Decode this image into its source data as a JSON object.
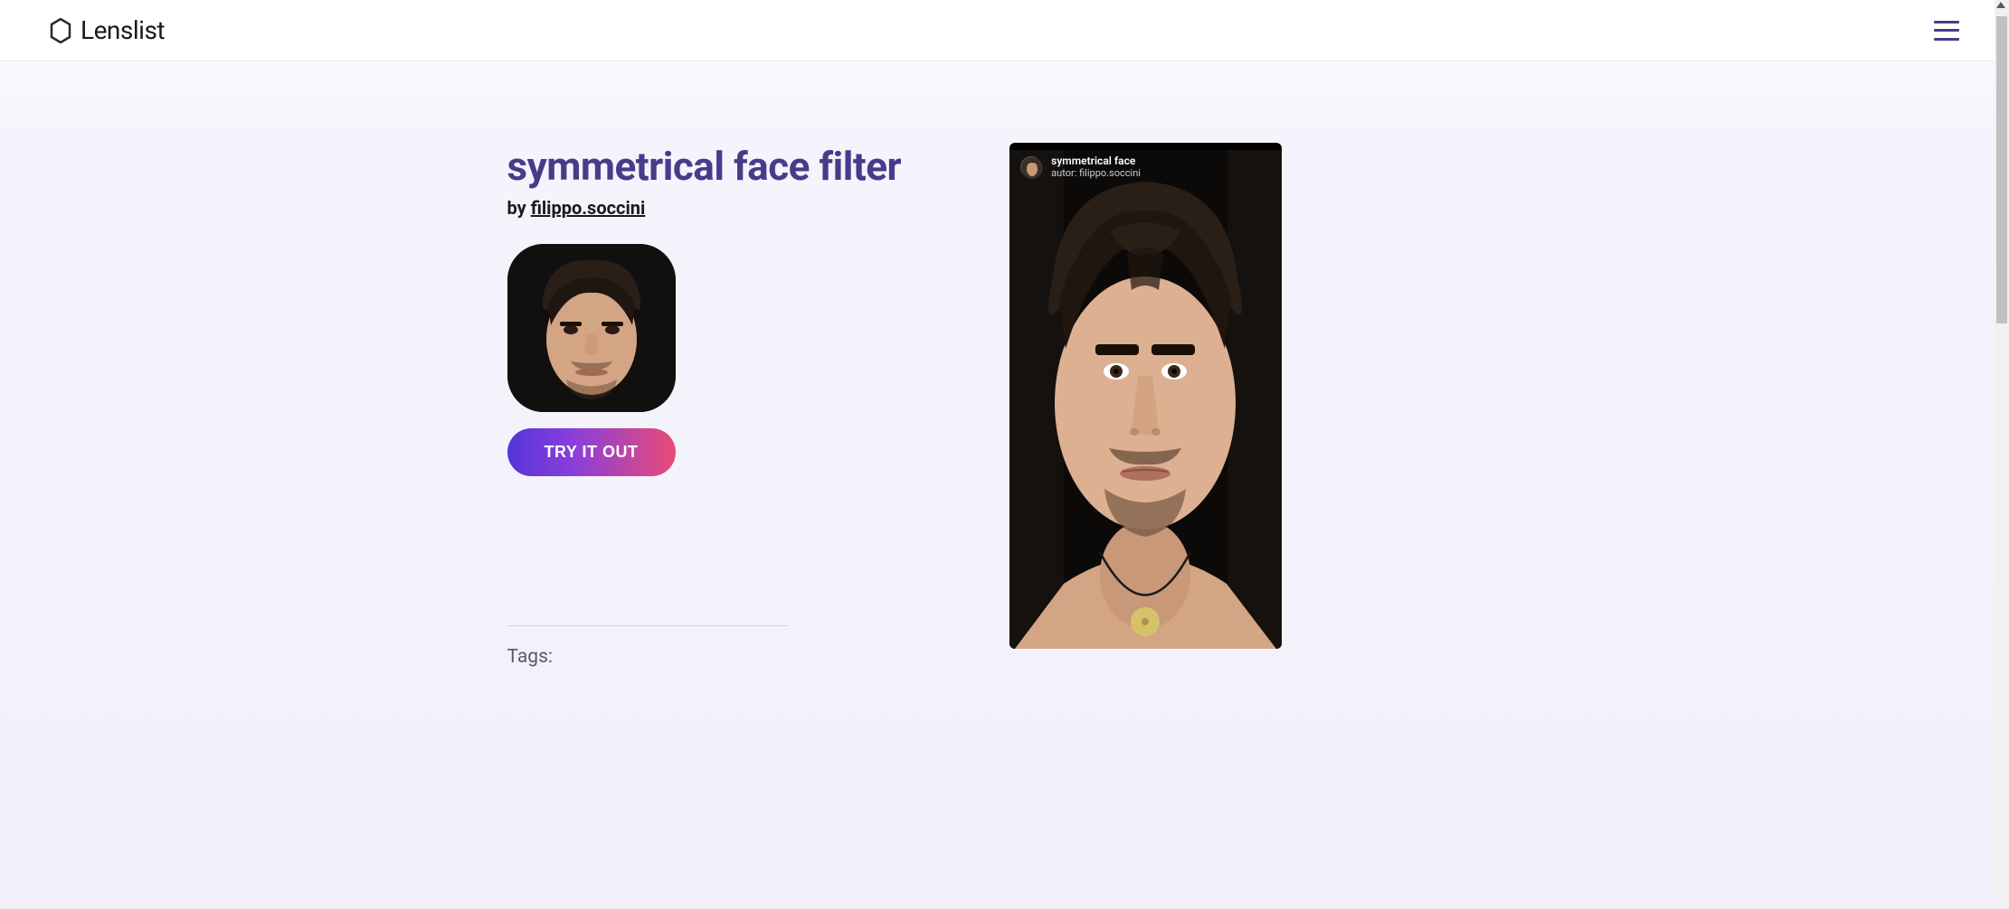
{
  "header": {
    "brand": "Lenslist"
  },
  "filter": {
    "title": "symmetrical face filter",
    "by_prefix": "by ",
    "author": "filippo.soccini",
    "try_label": "TRY IT OUT",
    "tags_label": "Tags:"
  },
  "preview": {
    "name": "symmetrical face",
    "author_line": "autor: filippo.soccini"
  }
}
